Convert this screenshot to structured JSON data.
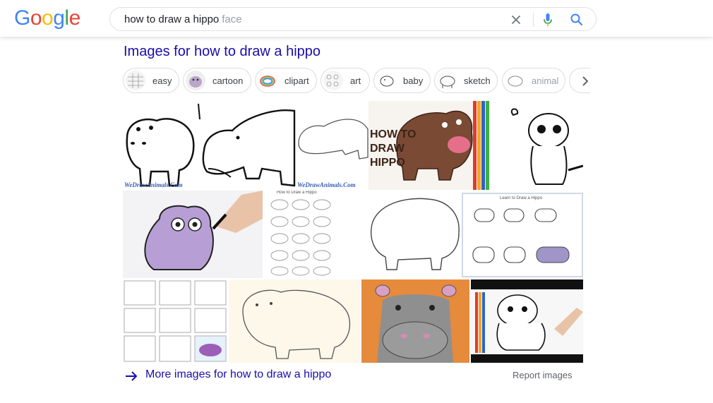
{
  "header": {
    "logo_letters": [
      {
        "char": "G",
        "color": "#4285F4"
      },
      {
        "char": "o",
        "color": "#EA4335"
      },
      {
        "char": "o",
        "color": "#FBBC05"
      },
      {
        "char": "g",
        "color": "#4285F4"
      },
      {
        "char": "l",
        "color": "#34A853"
      },
      {
        "char": "e",
        "color": "#EA4335"
      }
    ],
    "search": {
      "query": "how to draw a hippo",
      "suggestion": "face"
    }
  },
  "images_section": {
    "title": "Images for how to draw a hippo",
    "chips": [
      {
        "label": "easy"
      },
      {
        "label": "cartoon"
      },
      {
        "label": "clipart"
      },
      {
        "label": "art"
      },
      {
        "label": "baby"
      },
      {
        "label": "sketch"
      },
      {
        "label": "animal"
      }
    ],
    "captions": {
      "wedraw_1": "WeDrawAnimals.Com",
      "wedraw_2": "WeDrawAnimals.Com",
      "how_to": [
        "HOW TO",
        "DRAW",
        "HIPPO"
      ],
      "how_to_draw_a_hippo": "How to Draw a Hippo",
      "learn_to_draw": "Learn to Draw a Hippo"
    },
    "more_link": "More images for how to draw a hippo",
    "report": "Report images"
  },
  "colors": {
    "link_blue": "#1a0dab",
    "chip_border": "#dadce0",
    "grey_text": "#5f6368"
  }
}
